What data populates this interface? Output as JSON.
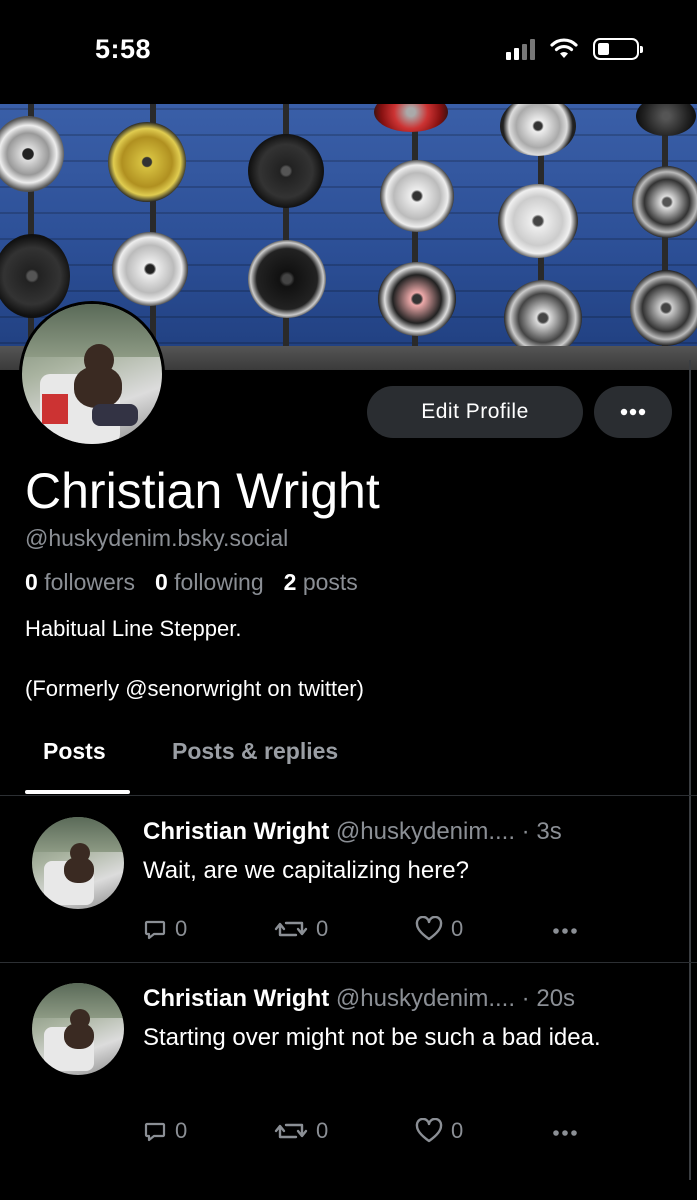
{
  "status_bar": {
    "time": "5:58"
  },
  "profile": {
    "name": "Christian Wright",
    "handle": "@huskydenim.bsky.social",
    "followers_count": "0",
    "followers_label": "followers",
    "following_count": "0",
    "following_label": "following",
    "posts_count": "2",
    "posts_label": "posts",
    "bio_line1": "Habitual Line Stepper.",
    "bio_line2": "(Formerly @senorwright on twitter)"
  },
  "buttons": {
    "edit_profile": "Edit Profile"
  },
  "tabs": [
    {
      "label": "Posts",
      "active": true
    },
    {
      "label": "Posts & replies",
      "active": false
    }
  ],
  "posts": [
    {
      "author": "Christian Wright",
      "handle": "@huskydenim....",
      "time": " · 3s",
      "text": "Wait, are we capitalizing here?",
      "replies": "0",
      "reposts": "0",
      "likes": "0"
    },
    {
      "author": "Christian Wright",
      "handle": "@huskydenim....",
      "time": " · 20s",
      "text": "Starting over might not be such a bad idea.",
      "replies": "0",
      "reposts": "0",
      "likes": "0"
    }
  ],
  "colors": {
    "background": "#000000",
    "muted_text": "#8b8f95",
    "button_bg": "#2a2d31"
  }
}
